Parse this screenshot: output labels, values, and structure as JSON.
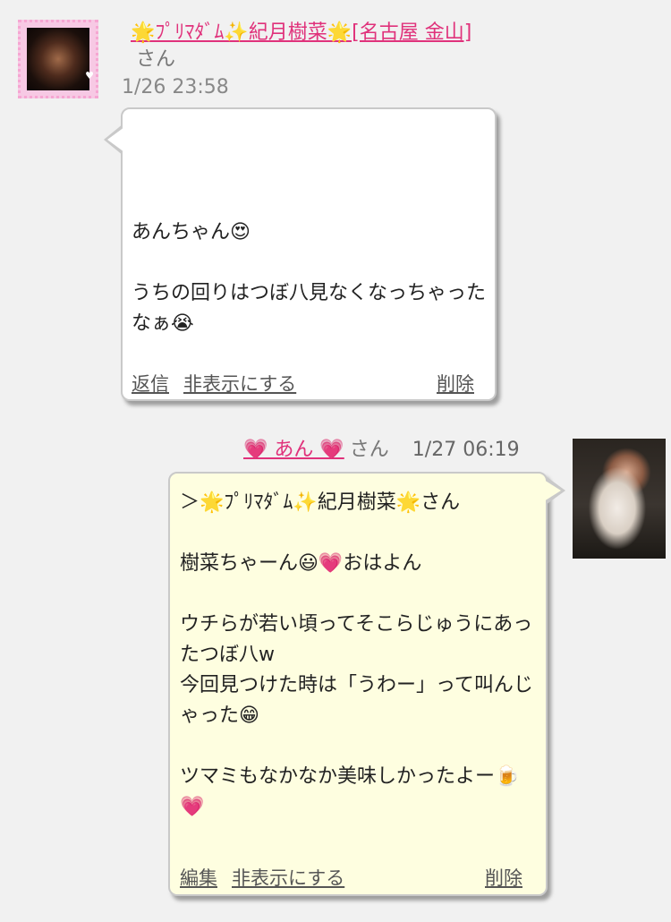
{
  "messages": [
    {
      "sender": "🌟ﾌﾟﾘﾏﾀﾞﾑ✨紀月樹菜🌟[名古屋 金山]",
      "honorific": "さん",
      "time": "1/26 23:58",
      "body": "あんちゃん😍\n\nうちの回りはつぼ八見なくなっちゃったなぁ😭",
      "actions": {
        "reply": "返信",
        "hide": "非表示にする",
        "delete": "削除"
      }
    },
    {
      "sender": "💗 あん 💗",
      "honorific": "さん",
      "time": "1/27 06:19",
      "body": "＞🌟ﾌﾟﾘﾏﾀﾞﾑ✨紀月樹菜🌟さん\n\n樹菜ちゃーん😃💗おはよん\n\nウチらが若い頃ってそこらじゅうにあったつぼ八w\n今回見つけた時は「うわー」って叫んじゃった😁\n\nツマミもなかなか美味しかったよー🍺💗",
      "actions": {
        "edit": "編集",
        "hide": "非表示にする",
        "delete": "削除"
      }
    }
  ],
  "colors": {
    "background": "#f1f1f1",
    "link": "#e0327b",
    "received_bubble": "#ffffff",
    "sent_bubble": "#fefee0"
  }
}
